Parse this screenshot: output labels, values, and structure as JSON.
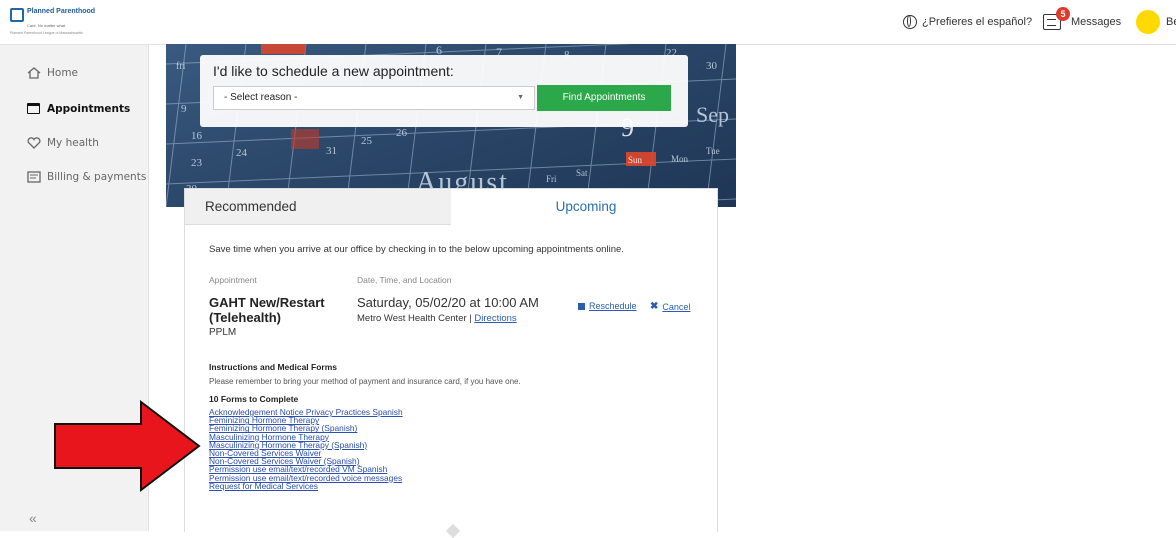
{
  "header": {
    "logo_line1": "Planned Parenthood",
    "logo_line2": "Care. No matter what.",
    "logo_line3": "Planned Parenthood League of Massachusetts",
    "language_label": "¿Prefieres el español?",
    "messages_label": "Messages",
    "messages_count": "5",
    "user_initial": "Be"
  },
  "sidebar": {
    "items": [
      {
        "label": "Home",
        "icon": "home-icon"
      },
      {
        "label": "Appointments",
        "icon": "calendar-icon",
        "active": true
      },
      {
        "label": "My health",
        "icon": "heart-icon"
      },
      {
        "label": "Billing & payments",
        "icon": "bill-icon"
      }
    ],
    "collapse_label": "«"
  },
  "schedule": {
    "title": "I'd like to schedule a new appointment:",
    "select_value": "- Select reason -",
    "button_label": "Find Appointments"
  },
  "tabs": {
    "recommended": "Recommended",
    "upcoming": "Upcoming"
  },
  "upcoming": {
    "intro": "Save time when you arrive at our office by checking in to the below upcoming appointments online.",
    "col_appointment": "Appointment",
    "col_datetime": "Date, Time, and Location",
    "appt_name": "GAHT New/Restart (Telehealth)",
    "appt_org": "PPLM",
    "appt_date": "Saturday, 05/02/20 at 10:00 AM",
    "appt_location": "Metro West Health Center | ",
    "directions_label": "Directions",
    "reschedule_label": "Reschedule",
    "cancel_label": "Cancel",
    "instructions_title": "Instructions and Medical Forms",
    "instructions_text": "Please remember to bring your method of payment and insurance card, if you have one.",
    "forms_title": "10 Forms to Complete",
    "forms": [
      "Acknowledgement Notice Privacy Practices Spanish",
      "Feminizing Hormone Therapy",
      "Feminizing Hormone Therapy (Spanish)",
      "Masculinizing Hormone Therapy",
      "Masculinizing Hormone Therapy (Spanish)",
      "Non-Covered Services Waiver",
      "Non-Covered Services Waiver (Spanish)",
      "Permission use email/text/recorded VM Spanish",
      "Permission use email/text/recorded voice messages",
      "Request for Medical Services"
    ]
  },
  "colors": {
    "accent_green": "#2ba84a",
    "link_blue": "#2a5db0",
    "annotation_arrow": "#e8161c",
    "avatar_yellow": "#ffd900"
  }
}
